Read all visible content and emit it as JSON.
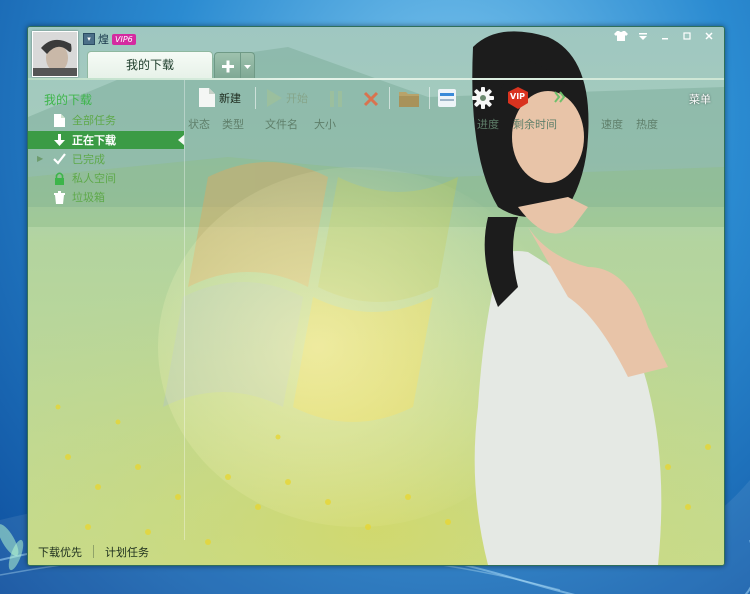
{
  "user": {
    "name": "煌",
    "vip_badge": "VIP6"
  },
  "tabs": {
    "main_label": "我的下载",
    "add_symbol": "+",
    "add_dropdown_symbol": "▾"
  },
  "sidebar": {
    "heading": "我的下载",
    "items": [
      {
        "label": "全部任务",
        "icon": "document-icon"
      },
      {
        "label": "正在下载",
        "icon": "download-arrow-icon",
        "active": true
      },
      {
        "label": "已完成",
        "icon": "checkmark-icon"
      },
      {
        "label": "私人空间",
        "icon": "lock-icon"
      },
      {
        "label": "垃圾箱",
        "icon": "trash-icon"
      }
    ]
  },
  "toolbar": {
    "new_label": "新建",
    "start_label": "开始",
    "menu_label": "菜单",
    "vip_icon_text": "VIP"
  },
  "columns": {
    "status": "状态",
    "type": "类型",
    "filename": "文件名",
    "size": "大小",
    "progress": "进度",
    "remaining": "剩余时间",
    "speed": "速度",
    "popularity": "热度"
  },
  "bottom": {
    "priority_label": "下载优先",
    "schedule_label": "计划任务"
  },
  "colors": {
    "accent_green": "#3db54a",
    "active_row": "#3b9b45",
    "vip_pink": "#d42aa0",
    "vip_red": "#d9331f"
  }
}
